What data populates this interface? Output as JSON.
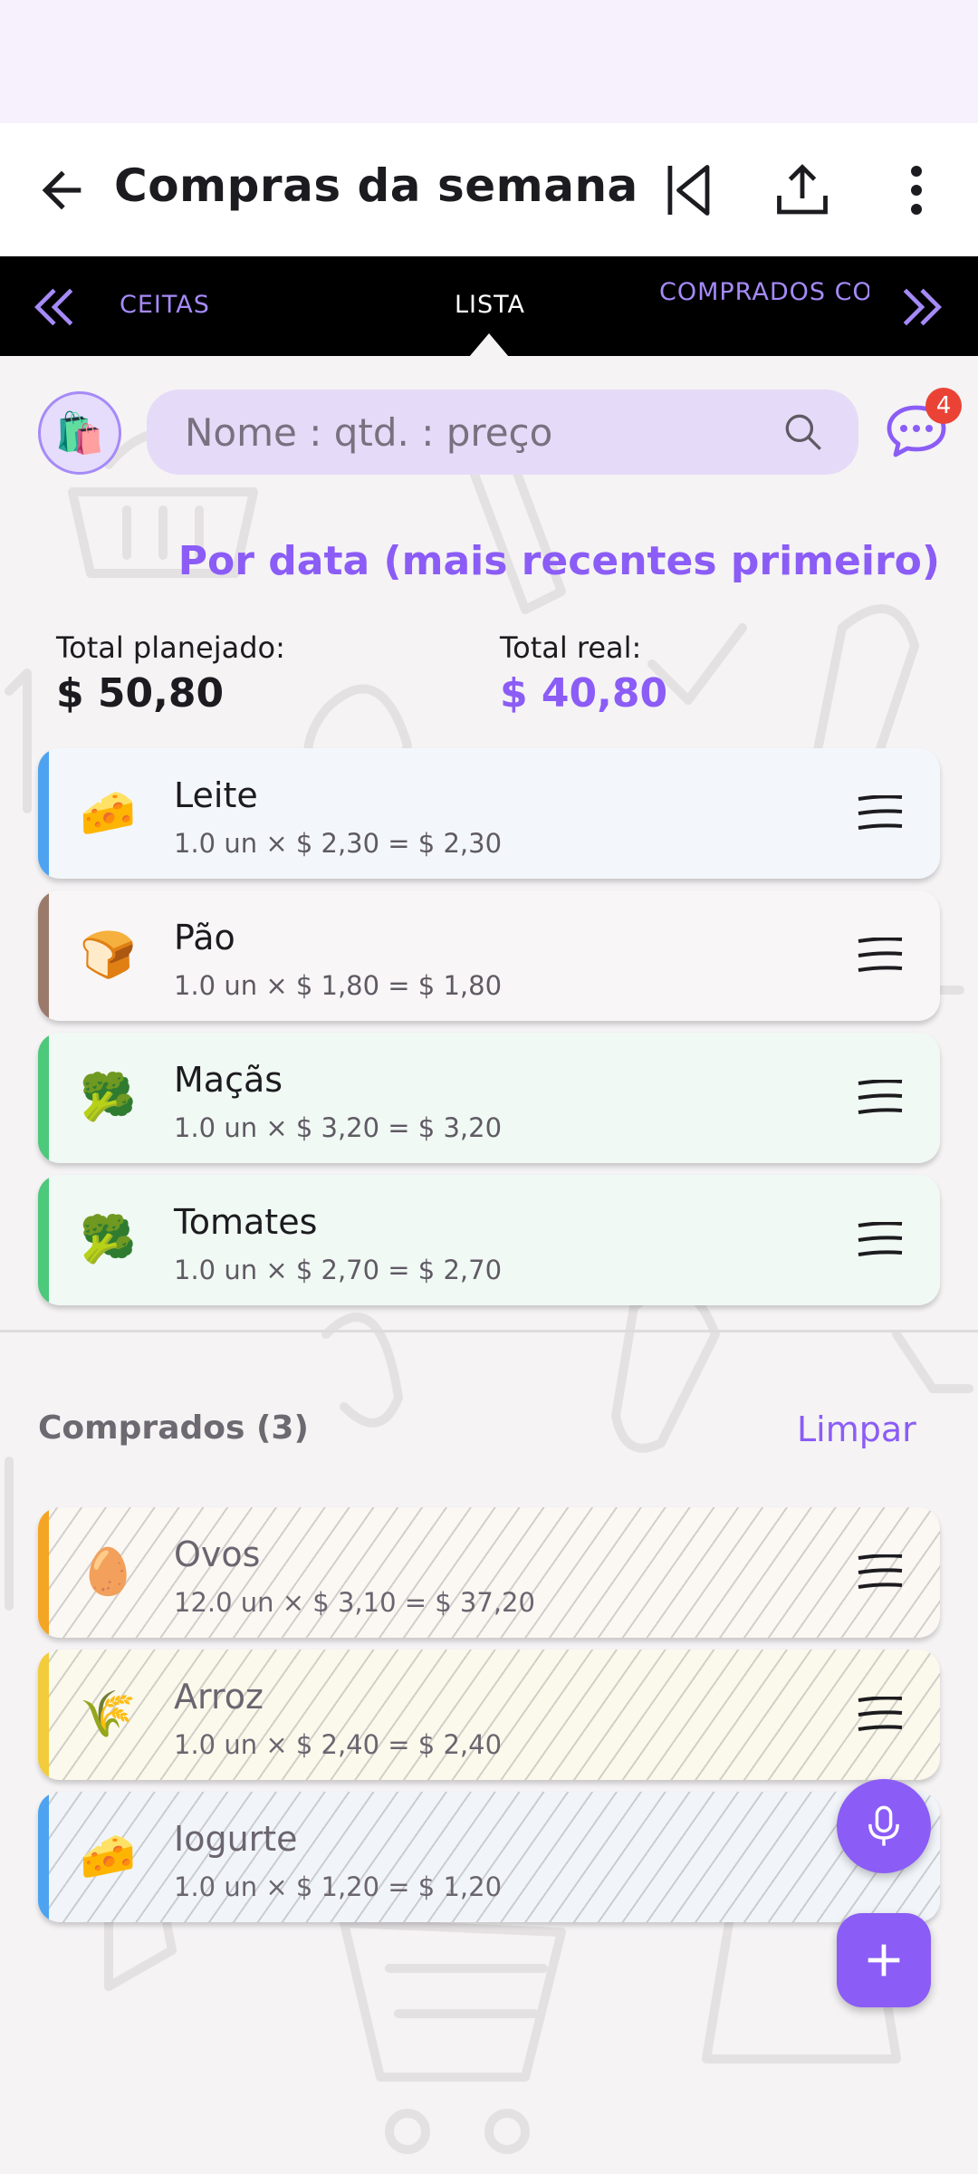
{
  "app_bar": {
    "title": "Compras da semana",
    "icons": [
      "back-arrow-icon",
      "skip-first-icon",
      "share-icon",
      "more-vert-icon"
    ]
  },
  "tabs": [
    {
      "label": "CEITAS",
      "active": false
    },
    {
      "label": "LISTA",
      "active": true
    },
    {
      "label": "COMPRADOS COM FREQUÊNCIA",
      "active": false
    }
  ],
  "search": {
    "placeholder": "Nome : qtd. : preço"
  },
  "notifications": {
    "count": "4"
  },
  "sort_label": "Por data (mais recentes primeiro)",
  "totals": {
    "planned_label": "Total planejado:",
    "planned_value": "$ 50,80",
    "real_label": "Total real:",
    "real_value": "$ 40,80"
  },
  "items": [
    {
      "icon": "🧀",
      "name": "Leite",
      "detail": "1.0 un × $ 2,30 = $ 2,30"
    },
    {
      "icon": "🍞",
      "name": "Pão",
      "detail": "1.0 un × $ 1,80 = $ 1,80"
    },
    {
      "icon": "🥦",
      "name": "Maçãs",
      "detail": "1.0 un × $ 3,20 = $ 3,20"
    },
    {
      "icon": "🥦",
      "name": "Tomates",
      "detail": "1.0 un × $ 2,70 = $ 2,70"
    }
  ],
  "bought": {
    "title": "Comprados (3)",
    "clear_label": "Limpar",
    "items": [
      {
        "icon": "🥚",
        "name": "Ovos",
        "detail": "12.0 un × $ 3,10 = $ 37,20"
      },
      {
        "icon": "🌾",
        "name": "Arroz",
        "detail": "1.0 un × $ 2,40 = $ 2,40"
      },
      {
        "icon": "🧀",
        "name": "Iogurte",
        "detail": "1.0 un × $ 1,20 = $ 1,20"
      }
    ]
  },
  "colors": {
    "accent": "#8b5cf6",
    "stripe_blue": "#4da3f0",
    "stripe_brown": "#9c7a6b",
    "stripe_green": "#4cc97a",
    "stripe_orange": "#f5a524",
    "stripe_yellow": "#f2cc3a"
  }
}
